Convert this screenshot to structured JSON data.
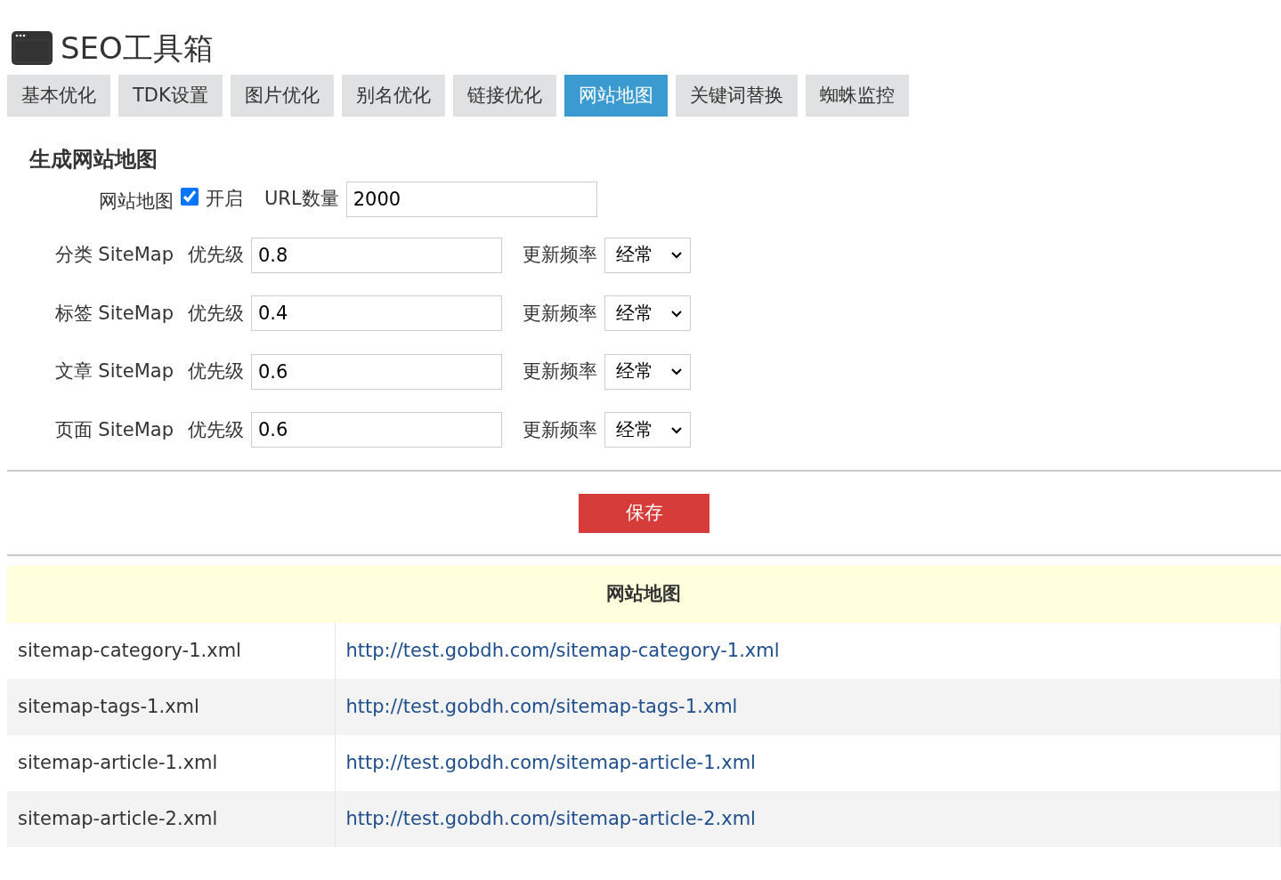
{
  "title": "SEO工具箱",
  "tabs": [
    {
      "label": "基本优化",
      "selected": false
    },
    {
      "label": "TDK设置",
      "selected": false
    },
    {
      "label": "图片优化",
      "selected": false
    },
    {
      "label": "别名优化",
      "selected": false
    },
    {
      "label": "链接优化",
      "selected": false
    },
    {
      "label": "网站地图",
      "selected": true
    },
    {
      "label": "关键词替换",
      "selected": false
    },
    {
      "label": "蜘蛛监控",
      "selected": false
    }
  ],
  "section_title": "生成网站地图",
  "enable_row": {
    "label": "网站地图",
    "checkbox_label": "开启",
    "checked": true,
    "count_label": "URL数量",
    "count_value": "2000"
  },
  "sitemap_rows": [
    {
      "label": "分类 SiteMap",
      "priority_label": "优先级",
      "priority": "0.8",
      "frequency_label": "更新频率",
      "frequency": "经常"
    },
    {
      "label": "标签 SiteMap",
      "priority_label": "优先级",
      "priority": "0.4",
      "frequency_label": "更新频率",
      "frequency": "经常"
    },
    {
      "label": "文章 SiteMap",
      "priority_label": "优先级",
      "priority": "0.6",
      "frequency_label": "更新频率",
      "frequency": "经常"
    },
    {
      "label": "页面 SiteMap",
      "priority_label": "优先级",
      "priority": "0.6",
      "frequency_label": "更新频率",
      "frequency": "经常"
    }
  ],
  "save_button": "保存",
  "table": {
    "title": "网站地图",
    "rows": [
      {
        "file": "sitemap-category-1.xml",
        "url": "http://test.gobdh.com/sitemap-category-1.xml"
      },
      {
        "file": "sitemap-tags-1.xml",
        "url": "http://test.gobdh.com/sitemap-tags-1.xml"
      },
      {
        "file": "sitemap-article-1.xml",
        "url": "http://test.gobdh.com/sitemap-article-1.xml"
      },
      {
        "file": "sitemap-article-2.xml",
        "url": "http://test.gobdh.com/sitemap-article-2.xml"
      }
    ]
  }
}
